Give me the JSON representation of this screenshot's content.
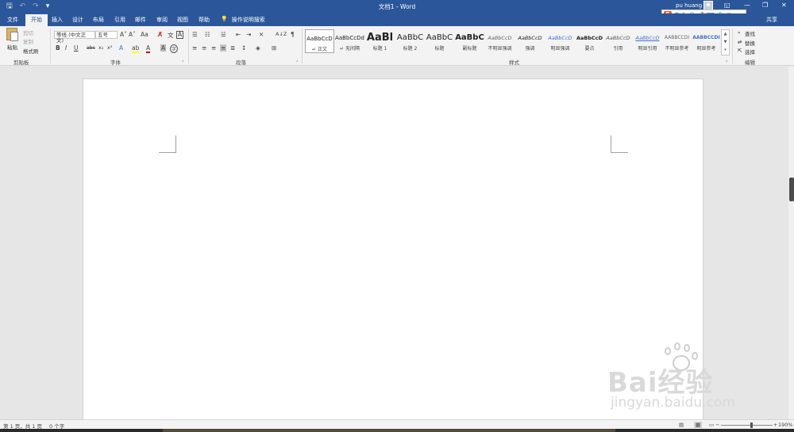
{
  "titlebar": {
    "title": "文档1 - Word",
    "user": "pu huang",
    "qat": {
      "save": "🖫",
      "undo": "↶",
      "redo": "↷",
      "customize": "▾"
    },
    "controls": {
      "ribbon_options": "◱",
      "minimize": "—",
      "restore": "❐",
      "close": "✕"
    }
  },
  "ime": {
    "logo": "S",
    "items": [
      "中",
      "°,",
      "☺",
      "🎤",
      "⌨",
      "👕",
      "▦"
    ]
  },
  "tabs": [
    "文件",
    "开始",
    "插入",
    "设计",
    "布局",
    "引用",
    "邮件",
    "审阅",
    "视图",
    "帮助"
  ],
  "active_tab": "开始",
  "tell_me": {
    "icon": "💡",
    "label": "操作说明搜索"
  },
  "share": "共享",
  "clipboard": {
    "paste": "粘贴",
    "cut": "剪切",
    "copy": "复制",
    "format_painter": "格式刷",
    "group": "剪贴板"
  },
  "font": {
    "name": "等线 (中文正文)",
    "size": "五号",
    "grow": "A˄",
    "shrink": "A˅",
    "change_case": "Aa",
    "clear": "A̸",
    "phonetic": "文",
    "border": "A",
    "bold": "B",
    "italic": "I",
    "underline": "U",
    "strike": "abc",
    "subscript": "x₂",
    "superscript": "x²",
    "effects": "A",
    "highlight": "ab",
    "color": "A",
    "shade": "A",
    "enclose": "字",
    "group": "字体"
  },
  "paragraph": {
    "group": "段落",
    "sort": "A↓Z",
    "marks": "¶"
  },
  "styles": {
    "group": "样式",
    "items": [
      {
        "sample": "AaBbCcD",
        "name": "↵ 正文"
      },
      {
        "sample": "AaBbCcDd",
        "name": "↵ 无间隔"
      },
      {
        "sample": "AaBl",
        "name": "标题 1"
      },
      {
        "sample": "AaBbC",
        "name": "标题 2"
      },
      {
        "sample": "AaBbC",
        "name": "标题"
      },
      {
        "sample": "AaBbC",
        "name": "副标题"
      },
      {
        "sample": "AaBbCcD",
        "name": "不明显强调"
      },
      {
        "sample": "AaBbCcD",
        "name": "强调"
      },
      {
        "sample": "AaBbCcD",
        "name": "明显强调"
      },
      {
        "sample": "AaBbCcD",
        "name": "要点"
      },
      {
        "sample": "AaBbCcD",
        "name": "引用"
      },
      {
        "sample": "AaBbCcD",
        "name": "明显引用"
      },
      {
        "sample": "AABBCCDI",
        "name": "不明显参考"
      },
      {
        "sample": "AABBCCDI",
        "name": "明显参考"
      }
    ]
  },
  "editing": {
    "group": "编辑",
    "find": "查找",
    "replace": "替换",
    "select": "选择"
  },
  "status": {
    "page": "第 1 页，共 1 页",
    "words": "0 个字",
    "zoom": "190%"
  },
  "watermark": {
    "brand": "Bai经验",
    "site": "jingyan.baidu.com"
  }
}
